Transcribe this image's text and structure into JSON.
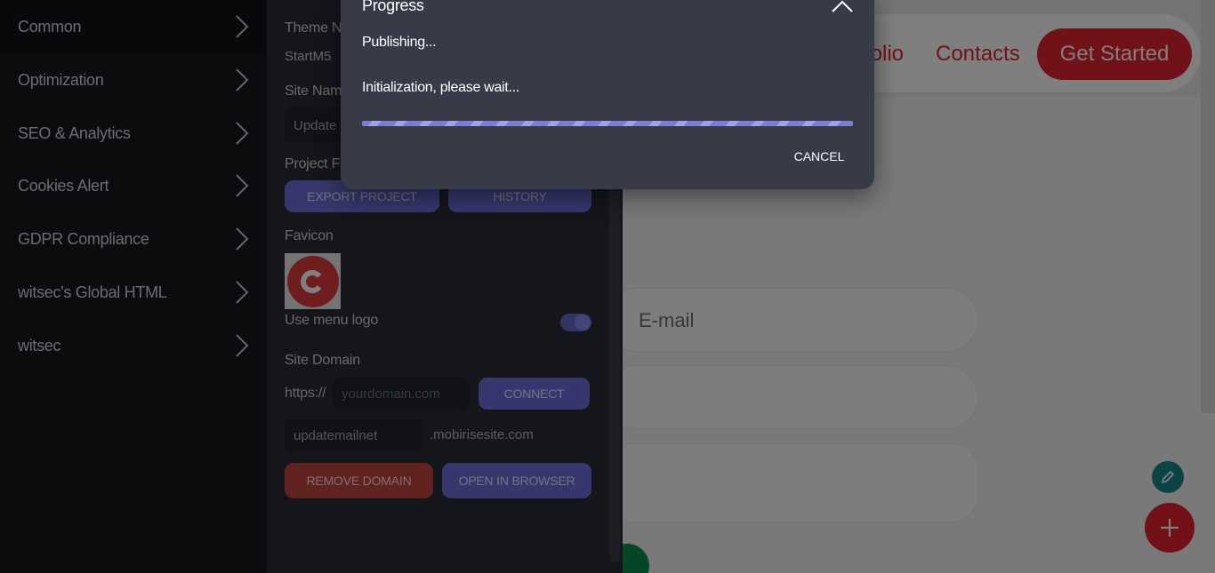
{
  "sidebar": {
    "items": [
      {
        "label": "Common"
      },
      {
        "label": "Optimization"
      },
      {
        "label": "SEO & Analytics"
      },
      {
        "label": "Cookies Alert"
      },
      {
        "label": "GDPR Compliance"
      },
      {
        "label": "witsec's Global HTML"
      },
      {
        "label": "witsec"
      }
    ]
  },
  "panel": {
    "theme_label": "Theme N",
    "theme_value": "StartM5",
    "site_name_label": "Site Nam",
    "site_name_value": "Update",
    "project_files_label": "Project Fi",
    "export_button": "EXPORT PROJECT",
    "history_button": "HISTORY",
    "favicon_label": "Favicon",
    "use_menu_logo_label": "Use menu logo",
    "use_menu_logo_on": true,
    "site_domain_label": "Site Domain",
    "protocol": "https://",
    "domain_placeholder": "yourdomain.com",
    "connect_button": "CONNECT",
    "subdomain_value": "updatemailnet",
    "subdomain_suffix": ".mobirisesite.com",
    "remove_domain_button": "REMOVE DOMAIN",
    "open_browser_button": "OPEN IN BROWSER"
  },
  "preview": {
    "nav_partial": "folio",
    "nav_contacts": "Contacts",
    "cta": "Get Started",
    "email_placeholder": "E-mail"
  },
  "modal": {
    "title": "Progress",
    "status": "Publishing...",
    "message": "Initialization, please wait...",
    "cancel_label": "CANCEL",
    "progress_fraction": 1.0
  },
  "colors": {
    "accent": "#6c6fd8",
    "danger": "#c0453f",
    "brand_red": "#e22433"
  }
}
